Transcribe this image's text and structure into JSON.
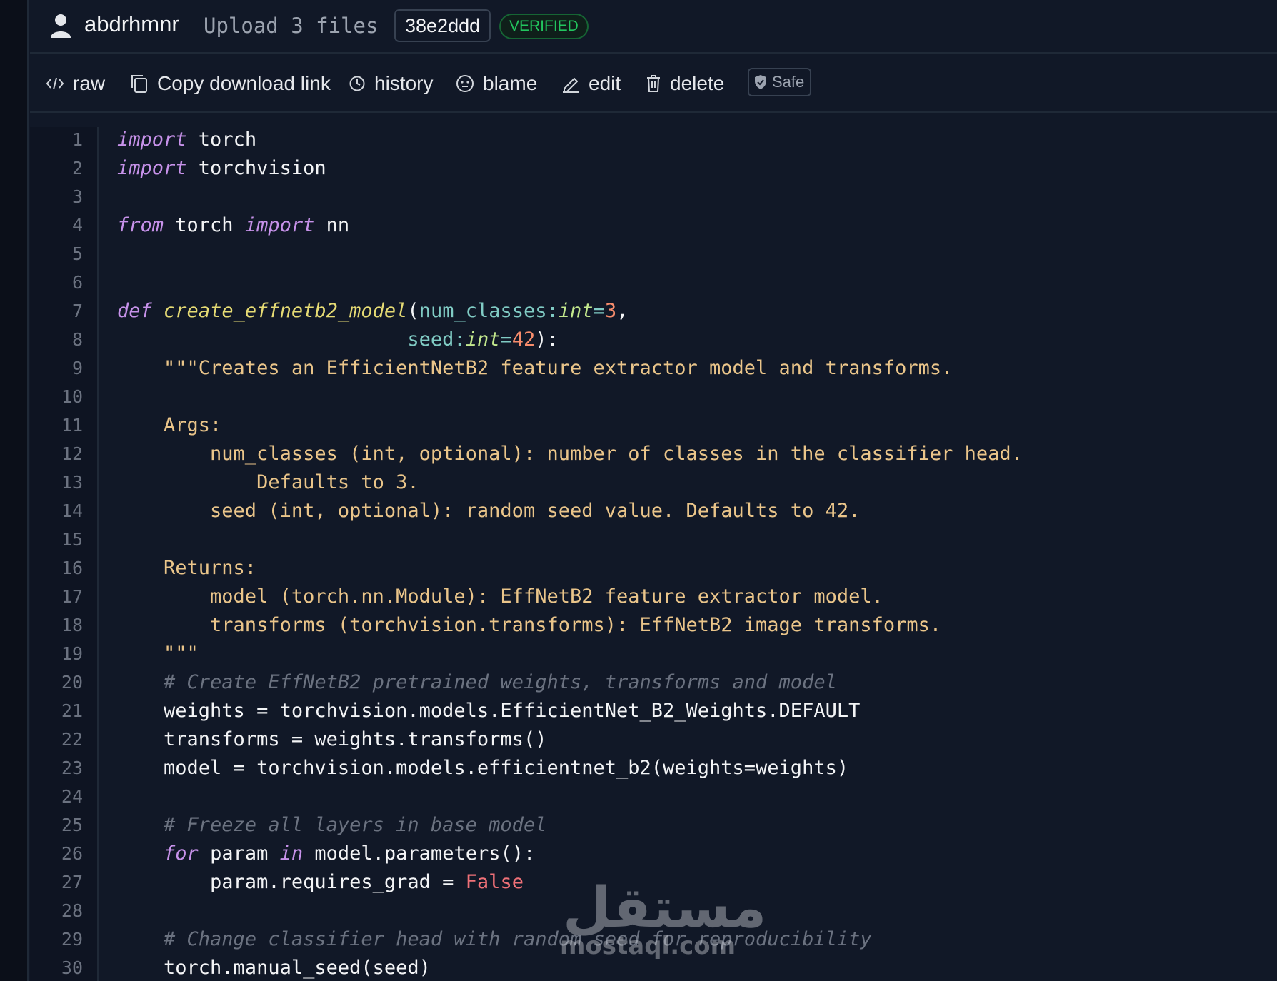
{
  "commit": {
    "author": "abdrhmnr",
    "message": "Upload 3 files",
    "hash": "38e2ddd",
    "verified_label": "VERIFIED"
  },
  "toolbar": {
    "raw_label": "raw",
    "copy_label": "Copy download link",
    "history_label": "history",
    "blame_label": "blame",
    "edit_label": "edit",
    "delete_label": "delete",
    "safe_label": "Safe"
  },
  "code": {
    "lines": [
      {
        "n": "1",
        "tokens": [
          {
            "t": "import",
            "c": "kw"
          },
          {
            "t": " torch",
            "c": "plain"
          }
        ]
      },
      {
        "n": "2",
        "tokens": [
          {
            "t": "import",
            "c": "kw"
          },
          {
            "t": " torchvision",
            "c": "plain"
          }
        ]
      },
      {
        "n": "3",
        "tokens": []
      },
      {
        "n": "4",
        "tokens": [
          {
            "t": "from",
            "c": "kw"
          },
          {
            "t": " torch ",
            "c": "plain"
          },
          {
            "t": "import",
            "c": "kw"
          },
          {
            "t": " nn",
            "c": "plain"
          }
        ]
      },
      {
        "n": "5",
        "tokens": []
      },
      {
        "n": "6",
        "tokens": []
      },
      {
        "n": "7",
        "tokens": [
          {
            "t": "def",
            "c": "kw"
          },
          {
            "t": " ",
            "c": "plain"
          },
          {
            "t": "create_effnetb2_model",
            "c": "fn"
          },
          {
            "t": "(",
            "c": "punct"
          },
          {
            "t": "num_classes",
            "c": "param"
          },
          {
            "t": ":",
            "c": "param"
          },
          {
            "t": "int",
            "c": "type"
          },
          {
            "t": "=",
            "c": "param"
          },
          {
            "t": "3",
            "c": "num"
          },
          {
            "t": ",",
            "c": "punct"
          }
        ]
      },
      {
        "n": "8",
        "tokens": [
          {
            "t": "                         ",
            "c": "plain"
          },
          {
            "t": "seed",
            "c": "param"
          },
          {
            "t": ":",
            "c": "param"
          },
          {
            "t": "int",
            "c": "type"
          },
          {
            "t": "=",
            "c": "param"
          },
          {
            "t": "42",
            "c": "num"
          },
          {
            "t": "):",
            "c": "punct"
          }
        ]
      },
      {
        "n": "9",
        "tokens": [
          {
            "t": "    \"\"\"Creates an EfficientNetB2 feature extractor model and transforms.",
            "c": "str"
          }
        ]
      },
      {
        "n": "10",
        "tokens": []
      },
      {
        "n": "11",
        "tokens": [
          {
            "t": "    Args:",
            "c": "str"
          }
        ]
      },
      {
        "n": "12",
        "tokens": [
          {
            "t": "        num_classes (int, optional): number of classes in the classifier head.",
            "c": "str"
          }
        ]
      },
      {
        "n": "13",
        "tokens": [
          {
            "t": "            Defaults to 3.",
            "c": "str"
          }
        ]
      },
      {
        "n": "14",
        "tokens": [
          {
            "t": "        seed (int, optional): random seed value. Defaults to 42.",
            "c": "str"
          }
        ]
      },
      {
        "n": "15",
        "tokens": []
      },
      {
        "n": "16",
        "tokens": [
          {
            "t": "    Returns:",
            "c": "str"
          }
        ]
      },
      {
        "n": "17",
        "tokens": [
          {
            "t": "        model (torch.nn.Module): EffNetB2 feature extractor model.",
            "c": "str"
          }
        ]
      },
      {
        "n": "18",
        "tokens": [
          {
            "t": "        transforms (torchvision.transforms): EffNetB2 image transforms.",
            "c": "str"
          }
        ]
      },
      {
        "n": "19",
        "tokens": [
          {
            "t": "    \"\"\"",
            "c": "str"
          }
        ]
      },
      {
        "n": "20",
        "tokens": [
          {
            "t": "    # Create EffNetB2 pretrained weights, transforms and model",
            "c": "com"
          }
        ]
      },
      {
        "n": "21",
        "tokens": [
          {
            "t": "    weights = torchvision.models.EfficientNet_B2_Weights.DEFAULT",
            "c": "plain"
          }
        ]
      },
      {
        "n": "22",
        "tokens": [
          {
            "t": "    transforms = weights.transforms()",
            "c": "plain"
          }
        ]
      },
      {
        "n": "23",
        "tokens": [
          {
            "t": "    model = torchvision.models.efficientnet_b2(weights=weights)",
            "c": "plain"
          }
        ]
      },
      {
        "n": "24",
        "tokens": []
      },
      {
        "n": "25",
        "tokens": [
          {
            "t": "    # Freeze all layers in base model",
            "c": "com"
          }
        ]
      },
      {
        "n": "26",
        "tokens": [
          {
            "t": "    ",
            "c": "plain"
          },
          {
            "t": "for",
            "c": "kw"
          },
          {
            "t": " param ",
            "c": "plain"
          },
          {
            "t": "in",
            "c": "kw"
          },
          {
            "t": " model.parameters():",
            "c": "plain"
          }
        ]
      },
      {
        "n": "27",
        "tokens": [
          {
            "t": "        param.requires_grad = ",
            "c": "plain"
          },
          {
            "t": "False",
            "c": "false"
          }
        ]
      },
      {
        "n": "28",
        "tokens": []
      },
      {
        "n": "29",
        "tokens": [
          {
            "t": "    # Change classifier head with random seed for reproducibility",
            "c": "com"
          }
        ]
      },
      {
        "n": "30",
        "tokens": [
          {
            "t": "    torch.manual_seed(seed)",
            "c": "plain"
          }
        ]
      }
    ]
  },
  "watermark": {
    "arabic": "مستقل",
    "latin": "mostaql.com"
  },
  "colors": {
    "background": "#111827",
    "keyword": "#c792ea",
    "function": "#e6db74",
    "string": "#eac58a",
    "comment": "#6b7280",
    "number": "#f78c6c",
    "verified": "#22c55e"
  }
}
